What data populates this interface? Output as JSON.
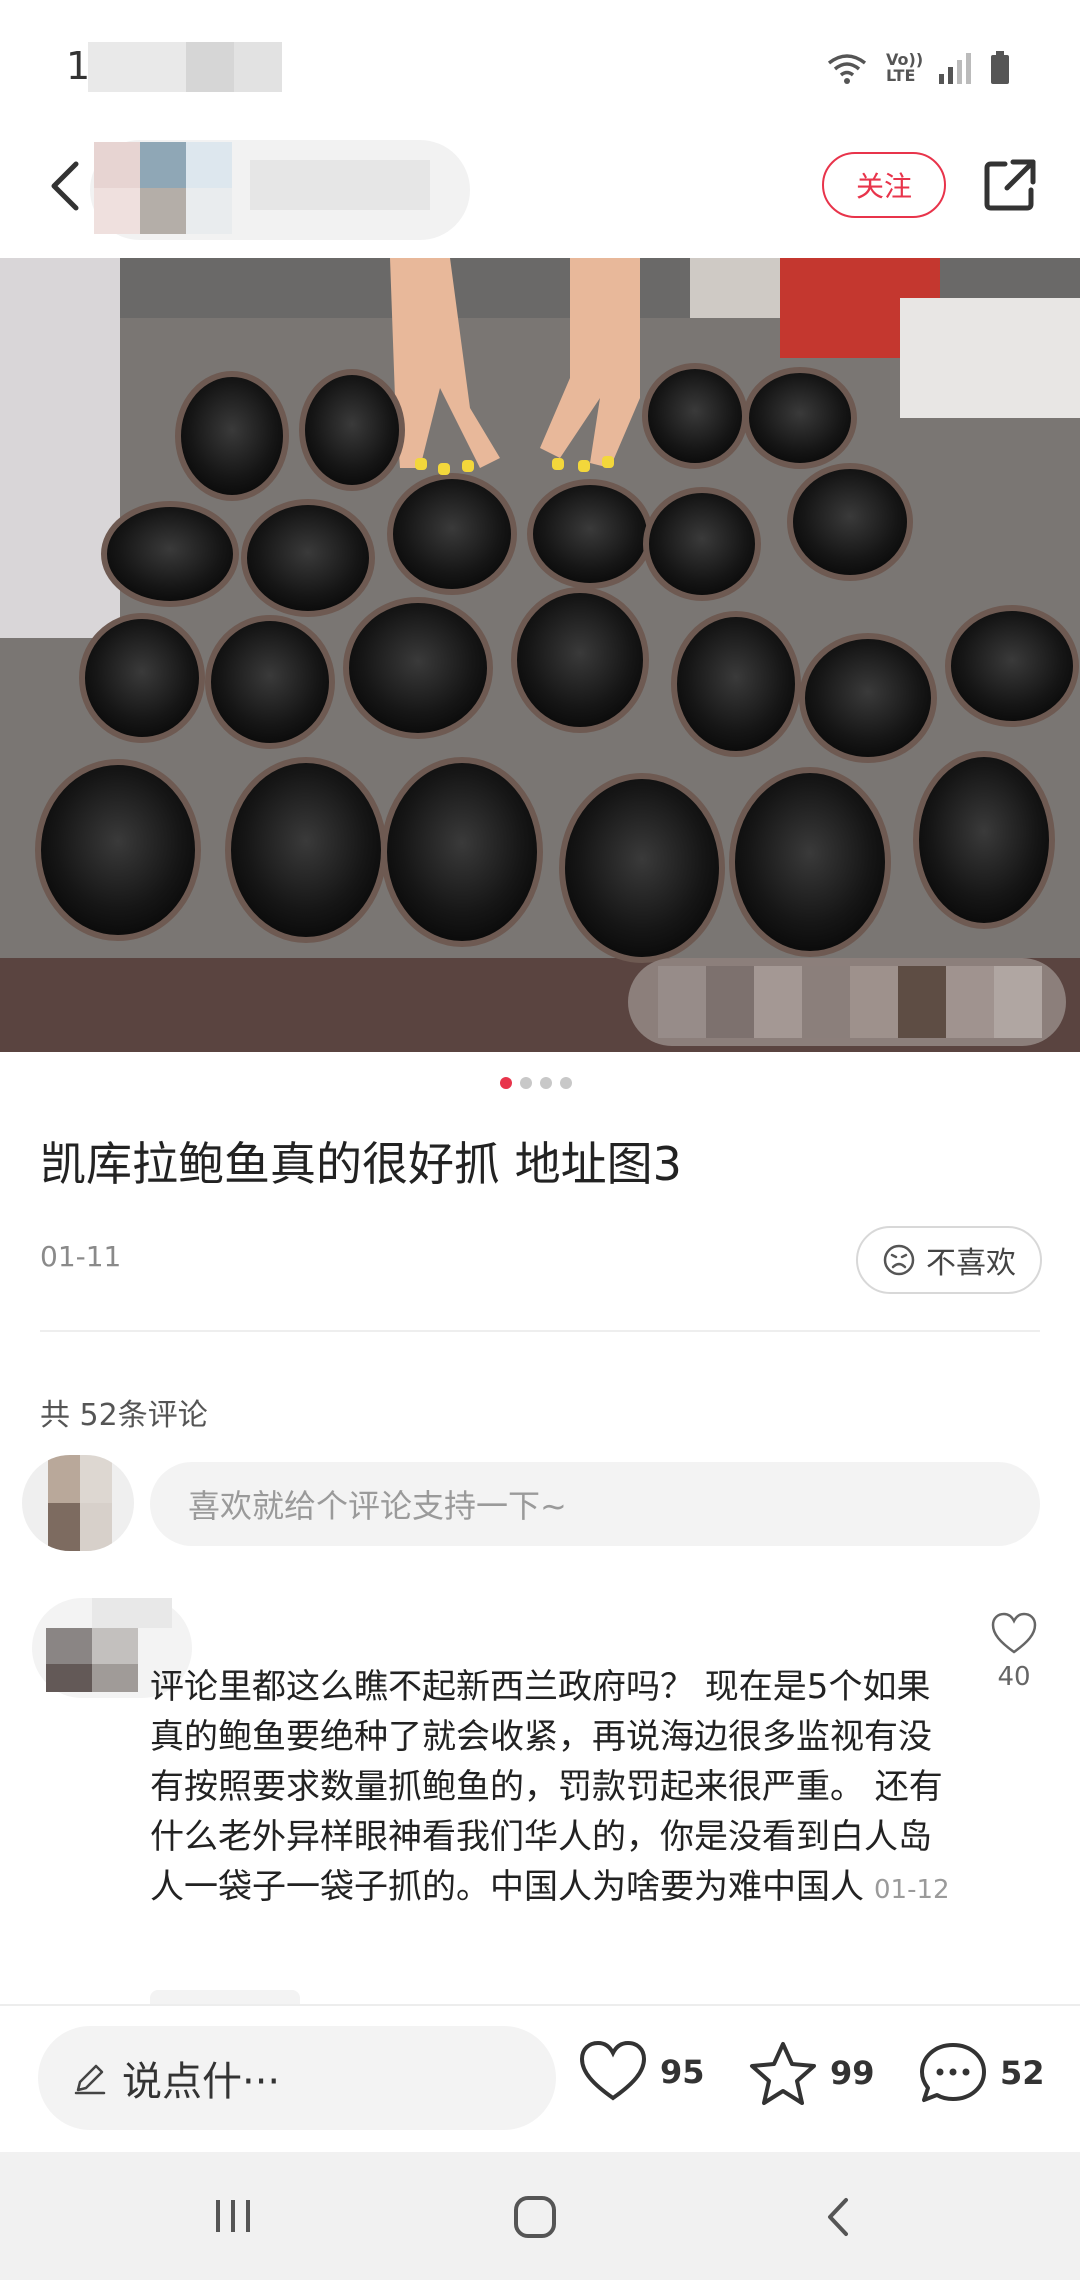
{
  "status_bar": {
    "time": "16:0",
    "network": "Vo)) LTE"
  },
  "header": {
    "follow_label": "关注"
  },
  "carousel": {
    "page_count": 4,
    "active_index": 0
  },
  "post": {
    "title": "凯库拉鲍鱼真的很好抓 地址图3",
    "date": "01-11",
    "dislike_label": "不喜欢"
  },
  "comments": {
    "count_label": "共 52条评论",
    "input_placeholder": "喜欢就给个评论支持一下~",
    "items": [
      {
        "text": "评论里都这么瞧不起新西兰政府吗？ 现在是5个如果真的鲍鱼要绝种了就会收紧，再说海边很多监视有没有按照要求数量抓鲍鱼的，罚款罚起来很严重。 还有什么老外异样眼神看我们华人的，你是没看到白人岛人一袋子一袋子抓的。中国人为啥要为难中国人",
        "date": "01-12",
        "likes": "40"
      }
    ]
  },
  "action_bar": {
    "input_label": "说点什···",
    "likes": "95",
    "favorites": "99",
    "comments": "52"
  },
  "colors": {
    "accent": "#e8344b",
    "background": "#ffffff"
  },
  "icons": [
    "back-arrow-icon",
    "share-icon",
    "dislike-face-icon",
    "heart-icon",
    "star-icon",
    "comment-bubble-icon",
    "pencil-icon",
    "recent-apps-icon",
    "home-icon",
    "nav-back-icon"
  ]
}
